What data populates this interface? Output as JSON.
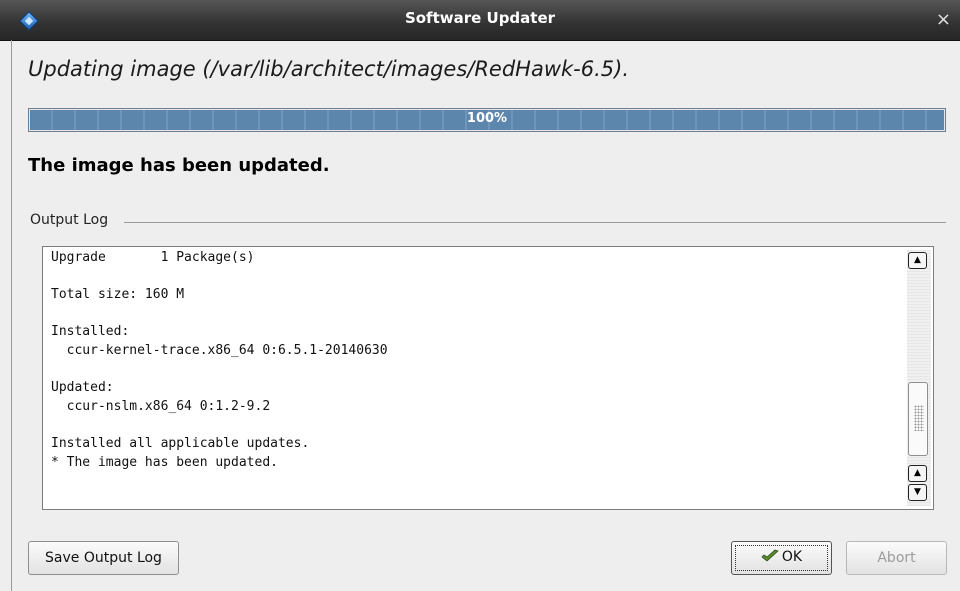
{
  "window": {
    "title": "Software Updater",
    "close_glyph": "×"
  },
  "heading": "Updating image (/var/lib/architect/images/RedHawk-6.5).",
  "progress": {
    "value_percent": 100,
    "label": "100%",
    "color": "#5d86ac"
  },
  "status_text": "The image has been updated.",
  "output_log": {
    "group_label": "Output Log",
    "text": "Upgrade       1 Package(s)\n\nTotal size: 160 M\n\nInstalled:\n  ccur-kernel-trace.x86_64 0:6.5.1-20140630\n\nUpdated:\n  ccur-nslm.x86_64 0:1.2-9.2\n\nInstalled all applicable updates.\n* The image has been updated."
  },
  "buttons": {
    "save_log": "Save Output Log",
    "ok": "OK",
    "abort": "Abort"
  },
  "icons": {
    "app": "app-diamond-icon",
    "ok": "checkmark-icon",
    "scroll_up": "▲",
    "scroll_down": "▼"
  }
}
